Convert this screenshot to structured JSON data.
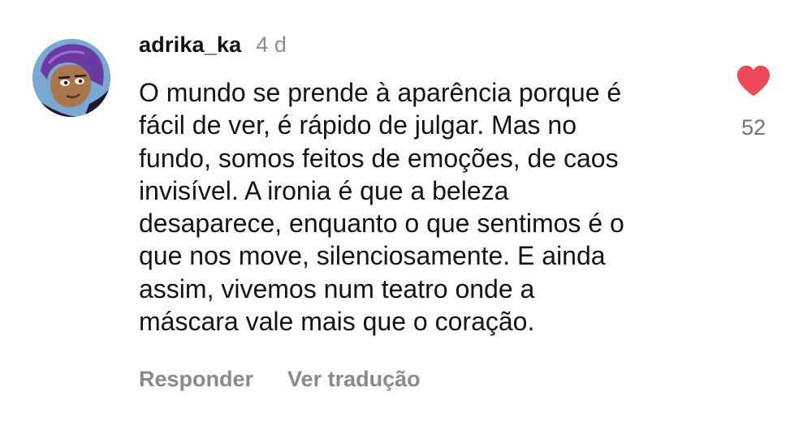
{
  "comment": {
    "username": "adrika_ka",
    "time": "4 d",
    "text": "O mundo se prende à aparência porque é\nfácil de ver, é rápido de julgar. Mas no\nfundo, somos feitos de emoções, de caos\ninvisível. A ironia é que a beleza\ndesaparece, enquanto o que sentimos é o\nque nos move, silenciosamente. E ainda\nassim, vivemos num teatro onde a\nmáscara vale mais que o coração.",
    "actions": {
      "reply_label": "Responder",
      "translate_label": "Ver tradução"
    },
    "likes": {
      "count": "52",
      "icon": "heart-icon",
      "liked": true,
      "color": "#ed4956"
    },
    "avatar": {
      "icon": "avatar",
      "background_color": "#7aa8d2"
    }
  }
}
